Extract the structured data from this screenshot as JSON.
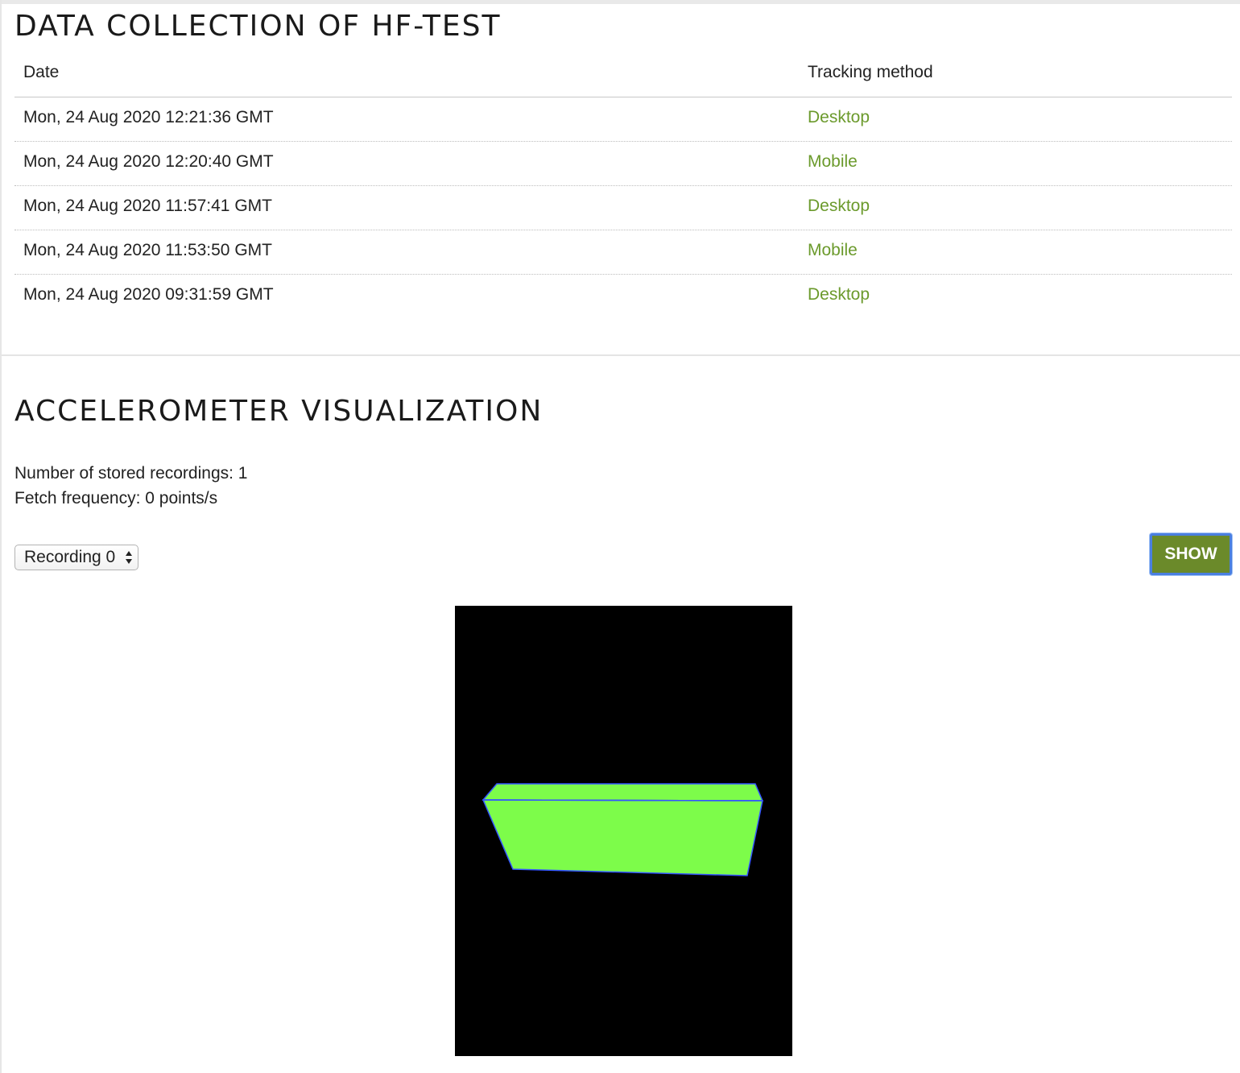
{
  "data_collection": {
    "title": "DATA COLLECTION OF HF-TEST",
    "columns": {
      "date": "Date",
      "method": "Tracking method"
    },
    "rows": [
      {
        "date": "Mon, 24 Aug 2020 12:21:36 GMT",
        "method": "Desktop"
      },
      {
        "date": "Mon, 24 Aug 2020 12:20:40 GMT",
        "method": "Mobile"
      },
      {
        "date": "Mon, 24 Aug 2020 11:57:41 GMT",
        "method": "Desktop"
      },
      {
        "date": "Mon, 24 Aug 2020 11:53:50 GMT",
        "method": "Mobile"
      },
      {
        "date": "Mon, 24 Aug 2020 09:31:59 GMT",
        "method": "Desktop"
      }
    ]
  },
  "accelerometer": {
    "title": "ACCELEROMETER VISUALIZATION",
    "recordings_text": "Number of stored recordings: 1",
    "frequency_text": "Fetch frequency: 0 points/s",
    "recording_select": {
      "selected": "Recording 0"
    },
    "show_button": "SHOW",
    "visualization": {
      "background": "#000000",
      "box_fill": "#7dfc4a",
      "edge_color": "#3355ff"
    }
  },
  "colors": {
    "link_green": "#6b9a2c",
    "button_green": "#6b8a2a",
    "focus_blue": "#4a7fe0"
  }
}
